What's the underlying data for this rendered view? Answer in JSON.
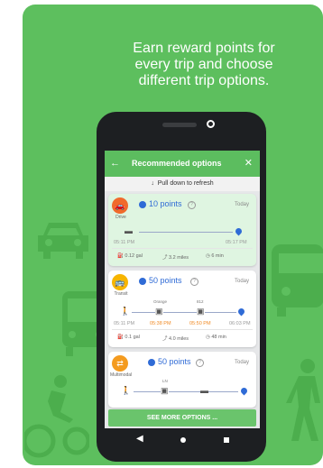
{
  "headline": {
    "line1": "Earn reward points for",
    "line2": "every trip and choose",
    "line3": "different trip options."
  },
  "colors": {
    "brand": "#5dbf5e",
    "accent_blue": "#2f6bd6",
    "drive": "#f06a2c",
    "transit": "#f7b500",
    "multimodal": "#f49b1f"
  },
  "appbar": {
    "back_icon": "arrow-left-icon",
    "title": "Recommended options",
    "close_icon": "close-icon"
  },
  "refresh": {
    "text": "Pull down to refresh"
  },
  "options": [
    {
      "mode": "Drive",
      "points": "10 points",
      "day": "Today",
      "depart": "05:11 PM",
      "arrive": "05:17 PM",
      "fuel": "0.12 gal",
      "distance": "3.2 miles",
      "duration": "6 min"
    },
    {
      "mode": "Transit",
      "points": "50 points",
      "day": "Today",
      "depart": "05:11 PM",
      "stop1_name": "Orange",
      "stop1_time": "05:38 PM",
      "stop2_name": "812",
      "stop2_time": "05:50 PM",
      "arrive": "06:03 PM",
      "fuel": "0.1 gal",
      "distance": "4.0 miles",
      "duration": "48 min"
    },
    {
      "mode": "Multimodal",
      "points": "50 points",
      "day": "Today",
      "stop1_name": "LN"
    }
  ],
  "more_button": "SEE MORE OPTIONS ..."
}
